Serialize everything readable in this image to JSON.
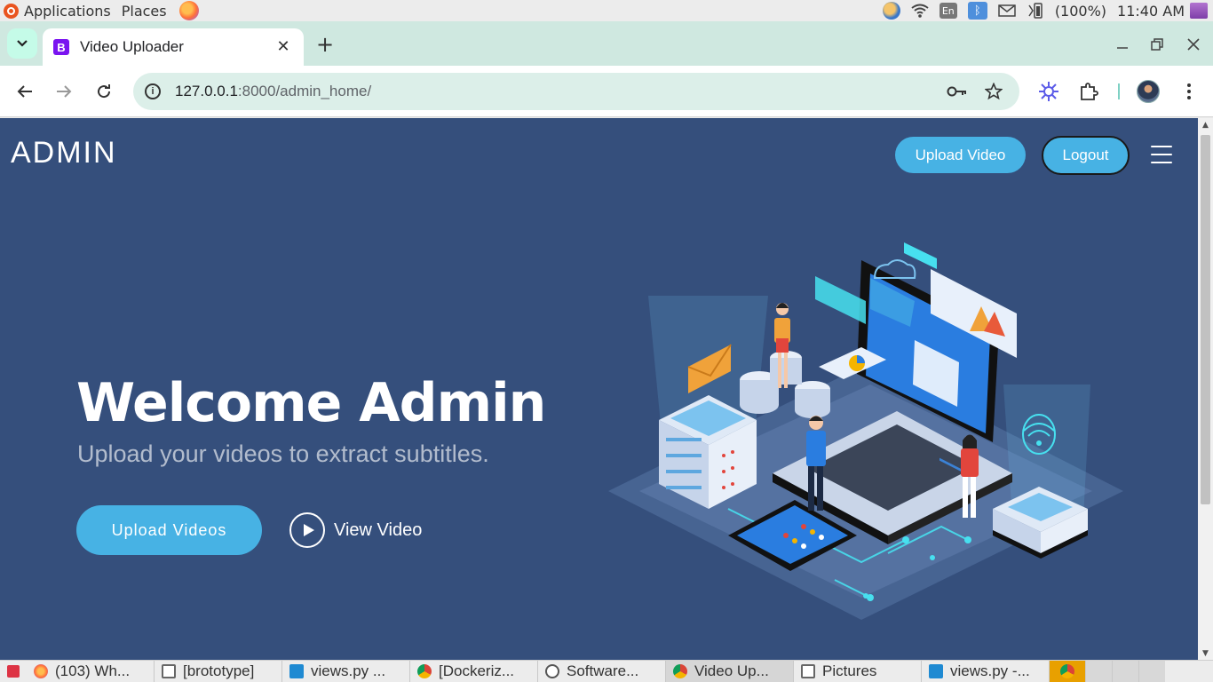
{
  "os_panel": {
    "menu_applications": "Applications",
    "menu_places": "Places",
    "keyboard_layout": "En",
    "battery": "(100%)",
    "clock": "11:40 AM"
  },
  "browser": {
    "tab": {
      "favicon_letter": "B",
      "title": "Video Uploader"
    },
    "address": {
      "host": "127.0.0.1",
      "rest": ":8000/admin_home/"
    }
  },
  "page": {
    "brand": "ADMIN",
    "nav": {
      "upload_label": "Upload Video",
      "logout_label": "Logout"
    },
    "hero": {
      "title": "Welcome Admin",
      "subtitle": "Upload your videos to extract subtitles.",
      "primary_button": "Upload Videos",
      "secondary_button": "View Video"
    },
    "colors": {
      "background": "#354f7c",
      "accent": "#47b2e4"
    }
  },
  "taskbar": {
    "items": [
      {
        "label": "(103) Wh...",
        "icon": "firefox-icon"
      },
      {
        "label": "[brototype]",
        "icon": "window-icon"
      },
      {
        "label": "views.py ...",
        "icon": "vscode-icon"
      },
      {
        "label": "[Dockeriz...",
        "icon": "chrome-icon"
      },
      {
        "label": "Software...",
        "icon": "software-icon"
      },
      {
        "label": "Video Up...",
        "icon": "chrome-icon",
        "active": true
      },
      {
        "label": "Pictures",
        "icon": "window-icon"
      },
      {
        "label": "views.py -...",
        "icon": "vscode-icon"
      }
    ]
  }
}
